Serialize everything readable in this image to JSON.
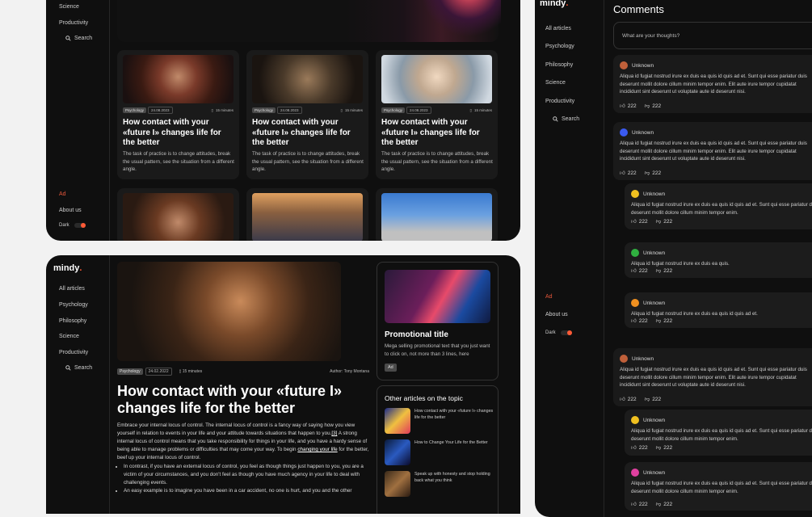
{
  "frame1": {
    "nav": [
      "Science",
      "Productivity"
    ],
    "search": "Search",
    "ad": "Ad",
    "about": "About us",
    "dark": "Dark",
    "cards": [
      {
        "tag": "Psychology",
        "date": "24.08.2023",
        "minutes": "15 minutes",
        "title": "How contact with your «future I» changes life for the better",
        "desc": "The task of practice is to change attitudes, break the usual pattern, see the situation from a different angle."
      },
      {
        "tag": "Psychology",
        "date": "24.08.2023",
        "minutes": "15 minutes",
        "title": "How contact with your «future I» changes life for the better",
        "desc": "The task of practice is to change attitudes, break the usual pattern, see the situation from a different angle."
      },
      {
        "tag": "Psychology",
        "date": "24.08.2023",
        "minutes": "15 minutes",
        "title": "How contact with your «future I» changes life for the better",
        "desc": "The task of practice is to change attitudes, break the usual pattern, see the situation from a different angle."
      }
    ]
  },
  "frame2": {
    "logo": "mindy",
    "nav": [
      "All articles",
      "Psychology",
      "Philosophy",
      "Science",
      "Productivity"
    ],
    "search": "Search",
    "article": {
      "tag": "Psychology",
      "date": "24.02.2022",
      "minutes": "15 minutes",
      "author_label": "Author:",
      "author": "Tony Montana",
      "title": "How contact with your «future I» changes life for the better",
      "p1a": "Embrace your internal locus of control. The internal locus of control is a fancy way of saying how you view yourself in relation to events in your life and your attitude towards situations that happen to you.",
      "p1ref": "[3]",
      "p1b": " A strong internal locus of control means that you take responsibility for things in your life, and you have a hardy sense of being able to manage problems or difficulties that may come your way. To begin ",
      "p1link": "changing your life",
      "p1c": " for the better, beef up your internal locus of control.",
      "b1": "In contrast, if you have an external locus of control, you feel as though things just happen to you, you are a victim of your circumstances, and you don't feel as though you have much agency in your life to deal with challenging events.",
      "b2": "An easy example is to imagine you have been in a car accident, no one is hurt, and you and the other"
    },
    "promo": {
      "title": "Promotional title",
      "desc": "Mega selling promotional text that you just want to click on, not more than 3 lines, here",
      "ad": "Ad"
    },
    "other": {
      "heading": "Other articles on the topic",
      "items": [
        "How contact with your «future I» changes life for the better",
        "How to Change Your Life for the Better",
        "Speak up with honesty and stop holding back what you think"
      ]
    }
  },
  "frame3": {
    "logo": "mindy",
    "nav": [
      "All articles",
      "Psychology",
      "Philosophy",
      "Science",
      "Productivity"
    ],
    "search": "Search",
    "ad": "Ad",
    "about": "About us",
    "dark": "Dark",
    "title": "Comments",
    "placeholder": "What are your thoughts?",
    "comments": [
      {
        "user": "Unknown",
        "text": "Aliqua id fugiat nostrud irure ex duis ea quis id quis ad et. Sunt qui esse pariatur duis deserunt mollit dolore cillum minim tempor enim. Elit aute irure tempor cupidatat incididunt sint deserunt ut voluptate aute id deserunt nisi.",
        "likes": "222",
        "dislikes": "222",
        "color": "#c0603a"
      },
      {
        "user": "Unknown",
        "text": "Aliqua id fugiat nostrud irure ex duis ea quis id quis ad et. Sunt qui esse pariatur duis deserunt mollit dolore cillum minim tempor enim. Elit aute irure tempor cupidatat incididunt sint deserunt ut voluptate aute id deserunt nisi.",
        "likes": "222",
        "dislikes": "222",
        "color": "#3a5af0"
      },
      {
        "user": "Unknown",
        "text": "Aliqua id fugiat nostrud irure ex duis ea quis id quis ad et. Sunt qui esse pariatur duis deserunt mollit dolore cillum minim tempor enim.",
        "likes": "222",
        "dislikes": "222",
        "color": "#f0c020"
      },
      {
        "user": "Unknown",
        "text": "Aliqua id fugiat nostrud irure ex duis ea quis.",
        "likes": "222",
        "dislikes": "222",
        "color": "#30b040"
      },
      {
        "user": "Unknown",
        "text": "Aliqua id fugiat nostrud irure ex duis ea quis id quis ad et.",
        "likes": "222",
        "dislikes": "222",
        "color": "#f09020"
      },
      {
        "user": "Unknown",
        "text": "Aliqua id fugiat nostrud irure ex duis ea quis id quis ad et. Sunt qui esse pariatur duis deserunt mollit dolore cillum minim tempor enim. Elit aute irure tempor cupidatat incididunt sint deserunt ut voluptate aute id deserunt nisi.",
        "likes": "222",
        "dislikes": "222",
        "color": "#c0603a"
      },
      {
        "user": "Unknown",
        "text": "Aliqua id fugiat nostrud irure ex duis ea quis id quis ad et. Sunt qui esse pariatur duis deserunt mollit dolore cillum minim tempor enim.",
        "likes": "222",
        "dislikes": "222",
        "color": "#f0c020"
      },
      {
        "user": "Unknown",
        "text": "Aliqua id fugiat nostrud irure ex duis ea quis id quis ad et. Sunt qui esse pariatur duis deserunt mollit dolore cillum minim tempor enim.",
        "likes": "222",
        "dislikes": "222",
        "color": "#e040a0"
      }
    ]
  },
  "colors": {
    "accent": "#ff5a36",
    "bg": "#0f0f0f",
    "card": "#1a1a1a"
  }
}
